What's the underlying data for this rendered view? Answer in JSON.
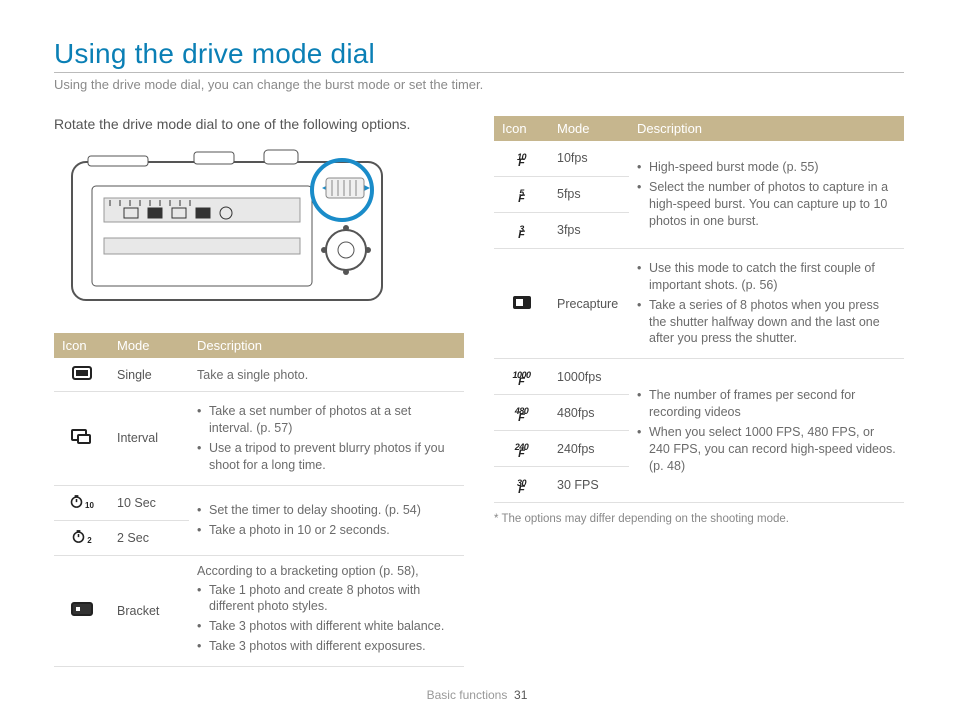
{
  "page": {
    "title": "Using the drive mode dial",
    "subtitle": "Using the drive mode dial, you can change the burst mode or set the timer.",
    "instruction": "Rotate the drive mode dial to one of the following options.",
    "footer_section": "Basic functions",
    "footer_page": "31",
    "footnote": "* The options may differ depending on the shooting mode."
  },
  "table_headers": {
    "icon": "Icon",
    "mode": "Mode",
    "description": "Description"
  },
  "left_table": [
    {
      "icon": "single",
      "mode": "Single",
      "pre": "",
      "bullets": [],
      "plain": "Take a single photo."
    },
    {
      "icon": "interval",
      "mode": "Interval",
      "pre": "",
      "bullets": [
        "Take a set number of photos at a set interval. (p. 57)",
        "Use a tripod to prevent blurry photos if you shoot for a long time."
      ],
      "plain": ""
    },
    {
      "icon": "timer10",
      "mode": "10 Sec",
      "shared": 0
    },
    {
      "icon": "timer2",
      "mode": "2 Sec",
      "shared": 0
    },
    {
      "icon": "bracket",
      "mode": "Bracket",
      "pre": "According to a bracketing option (p. 58),",
      "bullets": [
        "Take 1 photo and create 8 photos with different photo styles.",
        "Take 3 photos with different white balance.",
        "Take 3 photos with different exposures."
      ],
      "plain": ""
    }
  ],
  "left_shared": [
    {
      "bullets": [
        "Set the timer to delay shooting. (p. 54)",
        "Take a photo in 10 or 2 seconds."
      ]
    }
  ],
  "right_table": [
    {
      "icon": "fps10",
      "mode": "10fps",
      "shared": 0
    },
    {
      "icon": "fps5",
      "mode": "5fps",
      "shared": 0
    },
    {
      "icon": "fps3",
      "mode": "3fps",
      "shared": 0
    },
    {
      "icon": "precap",
      "mode": "Precapture",
      "bullets": [
        "Use this mode to catch the first couple of important shots. (p. 56)",
        "Take a series of 8 photos when you press the shutter halfway down and the last one after you press the shutter."
      ]
    },
    {
      "icon": "fps1000",
      "mode": "1000fps",
      "shared": 1
    },
    {
      "icon": "fps480",
      "mode": "480fps",
      "shared": 1
    },
    {
      "icon": "fps240",
      "mode": "240fps",
      "shared": 1
    },
    {
      "icon": "fps30",
      "mode": "30 FPS",
      "shared": 1
    }
  ],
  "right_shared": [
    {
      "bullets": [
        "High-speed burst mode (p. 55)",
        "Select the number of photos to capture in a high-speed burst. You can capture up to 10 photos in one burst."
      ]
    },
    {
      "bullets": [
        "The number of frames per second for recording videos",
        "When you select 1000 FPS, 480 FPS, or 240 FPS, you can record high-speed videos. (p. 48)"
      ]
    }
  ],
  "icon_labels": {
    "fps10": "10",
    "fps5": "5",
    "fps3": "3",
    "fps1000": "1000",
    "fps480": "480",
    "fps240": "240",
    "fps30": "30",
    "timer10": "10",
    "timer2": "2"
  }
}
